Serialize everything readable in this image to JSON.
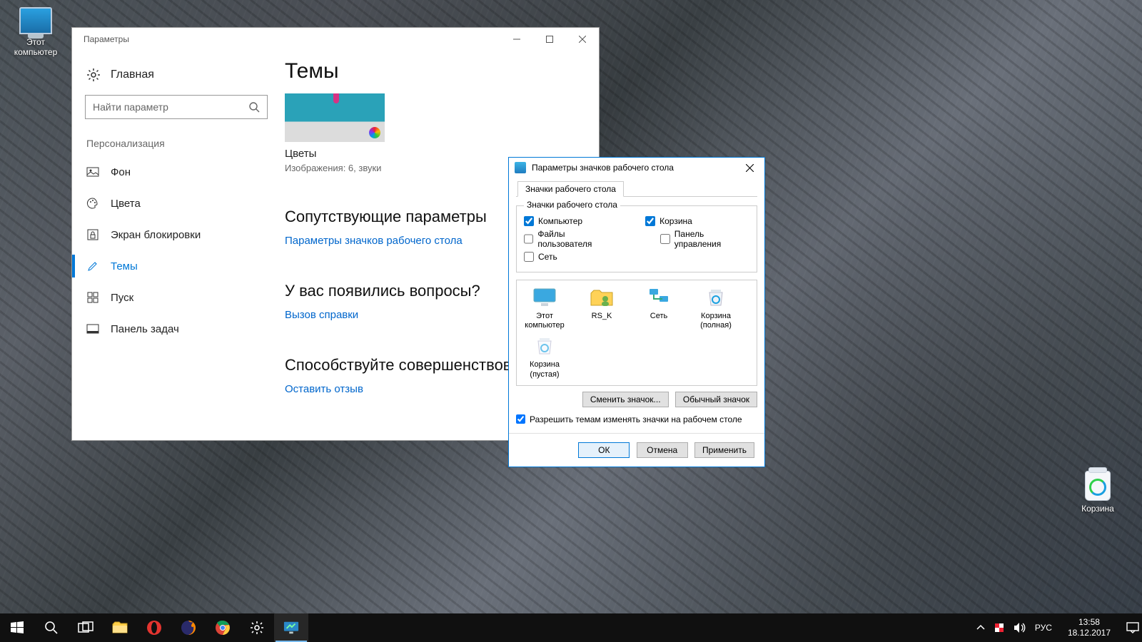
{
  "desktop": {
    "this_pc": "Этот компьютер",
    "recycle_bin": "Корзина"
  },
  "settings": {
    "title": "Параметры",
    "home": "Главная",
    "search_placeholder": "Найти параметр",
    "section": "Персонализация",
    "nav": {
      "background": "Фон",
      "colors": "Цвета",
      "lockscreen": "Экран блокировки",
      "themes": "Темы",
      "start": "Пуск",
      "taskbar": "Панель задач"
    },
    "main": {
      "heading": "Темы",
      "theme_name": "Цветы",
      "theme_sub": "Изображения: 6, звуки",
      "related_heading": "Сопутствующие параметры",
      "related_link": "Параметры значков рабочего стола",
      "help_heading": "У вас появились вопросы?",
      "help_link": "Вызов справки",
      "feedback_heading": "Способствуйте совершенствованию",
      "feedback_link": "Оставить отзыв"
    }
  },
  "dialog": {
    "title": "Параметры значков рабочего стола",
    "tab": "Значки рабочего стола",
    "group": "Значки рабочего стола",
    "checks": {
      "computer": "Компьютер",
      "recycle_bin": "Корзина",
      "user_files": "Файлы пользователя",
      "control_panel": "Панель управления",
      "network": "Сеть"
    },
    "icons": {
      "this_pc": "Этот компьютер",
      "user": "RS_K",
      "network": "Сеть",
      "bin_full": "Корзина (полная)",
      "bin_empty": "Корзина (пустая)"
    },
    "change_icon": "Сменить значок...",
    "default_icon": "Обычный значок",
    "allow_themes": "Разрешить темам изменять значки на рабочем столе",
    "ok": "ОК",
    "cancel": "Отмена",
    "apply": "Применить"
  },
  "taskbar": {
    "lang": "РУС",
    "time": "13:58",
    "date": "18.12.2017"
  }
}
